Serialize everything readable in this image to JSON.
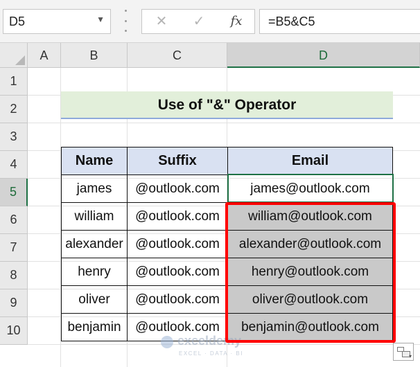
{
  "formula_bar": {
    "name_box": "D5",
    "formula": "=B5&C5",
    "cancel_glyph": "✕",
    "enter_glyph": "✓",
    "fx_glyph": "fx"
  },
  "columns": [
    "A",
    "B",
    "C",
    "D"
  ],
  "rows": [
    "1",
    "2",
    "3",
    "4",
    "5",
    "6",
    "7",
    "8",
    "9",
    "10"
  ],
  "selected_column": "D",
  "title": "Use of \"&\" Operator",
  "table": {
    "headers": [
      "Name",
      "Suffix",
      "Email"
    ],
    "rows": [
      [
        "james",
        "@outlook.com",
        "james@outlook.com"
      ],
      [
        "william",
        "@outlook.com",
        "william@outlook.com"
      ],
      [
        "alexander",
        "@outlook.com",
        "alexander@outlook.com"
      ],
      [
        "henry",
        "@outlook.com",
        "henry@outlook.com"
      ],
      [
        "oliver",
        "@outlook.com",
        "oliver@outlook.com"
      ],
      [
        "benjamin",
        "@outlook.com",
        "benjamin@outlook.com"
      ]
    ]
  },
  "watermark": {
    "brand": "exceldemy",
    "tagline": "EXCEL · DATA · BI"
  },
  "colors": {
    "title_fill": "#e2efda",
    "header_fill": "#d9e1f2",
    "result_fill": "#c9c9c9",
    "highlight_border": "#ff0000",
    "selection_green": "#1e7145"
  },
  "icons": [
    "cancel-icon",
    "enter-icon",
    "function-icon",
    "chevron-down-icon",
    "quick-analysis-icon",
    "select-all-icon"
  ]
}
